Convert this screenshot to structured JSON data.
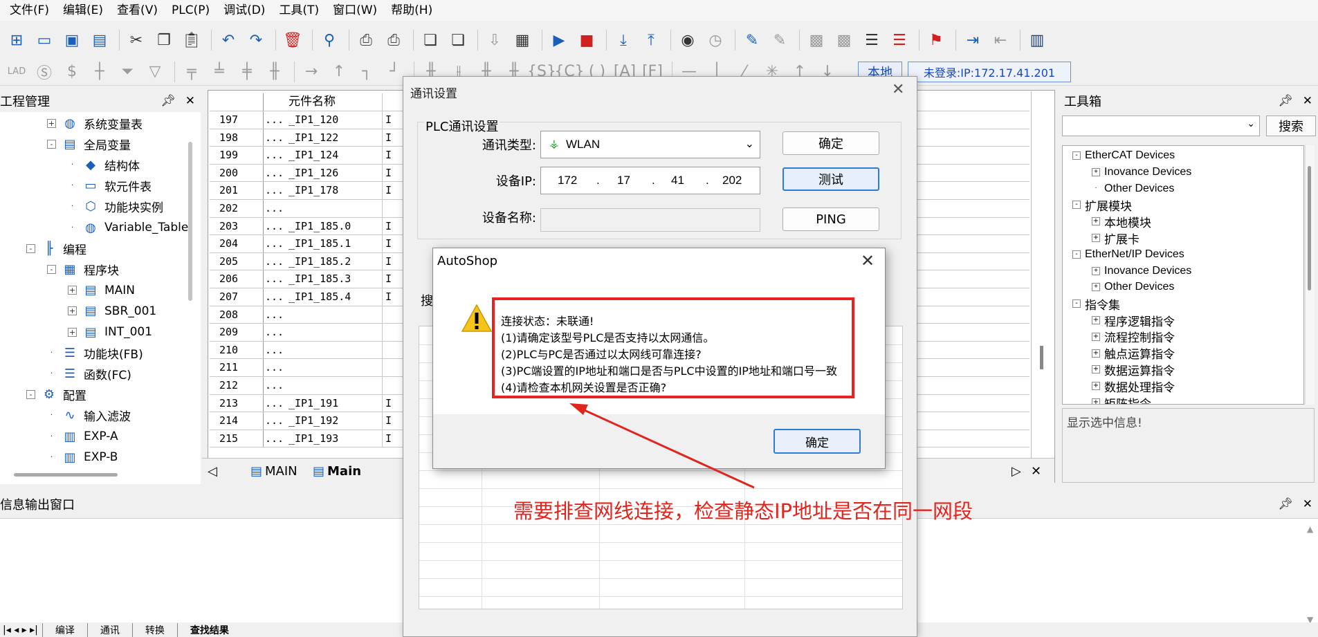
{
  "menu": [
    "文件(F)",
    "编辑(E)",
    "查看(V)",
    "PLC(P)",
    "调试(D)",
    "工具(T)",
    "窗口(W)",
    "帮助(H)"
  ],
  "toolbar": {
    "local_label": "本地",
    "login_status": "未登录:IP:172.17.41.201"
  },
  "project": {
    "title": "工程管理",
    "nodes": [
      {
        "label": "系统变量表",
        "level": 1,
        "box": "+",
        "icon": "globe-icon"
      },
      {
        "label": "全局变量",
        "level": 1,
        "box": "-",
        "icon": "table-icon"
      },
      {
        "label": "结构体",
        "level": 2,
        "box": "",
        "icon": "struct-icon"
      },
      {
        "label": "软元件表",
        "level": 2,
        "box": "",
        "icon": "device-table-icon"
      },
      {
        "label": "功能块实例",
        "level": 2,
        "box": "",
        "icon": "cube-icon"
      },
      {
        "label": "Variable_Table",
        "level": 2,
        "box": "",
        "icon": "globe-icon"
      },
      {
        "label": "编程",
        "level": 0,
        "box": "-",
        "icon": "ladder-icon"
      },
      {
        "label": "程序块",
        "level": 1,
        "box": "-",
        "icon": "blocks-icon"
      },
      {
        "label": "MAIN",
        "level": 2,
        "box": "+",
        "icon": "main-program-icon"
      },
      {
        "label": "SBR_001",
        "level": 2,
        "box": "+",
        "icon": "subroutine-icon"
      },
      {
        "label": "INT_001",
        "level": 2,
        "box": "+",
        "icon": "interrupt-icon"
      },
      {
        "label": "功能块(FB)",
        "level": 1,
        "box": "",
        "icon": "fb-icon"
      },
      {
        "label": "函数(FC)",
        "level": 1,
        "box": "",
        "icon": "fc-icon"
      },
      {
        "label": "配置",
        "level": 0,
        "box": "-",
        "icon": "config-icon"
      },
      {
        "label": "输入滤波",
        "level": 1,
        "box": "",
        "icon": "filter-icon"
      },
      {
        "label": "EXP-A",
        "level": 1,
        "box": "",
        "icon": "module-icon"
      },
      {
        "label": "EXP-B",
        "level": 1,
        "box": "",
        "icon": "module-icon"
      }
    ]
  },
  "editor": {
    "header": "元件名称",
    "rows": [
      {
        "n": "197",
        "d": "...",
        "name": "_IP1_120",
        "t": "I"
      },
      {
        "n": "198",
        "d": "...",
        "name": "_IP1_122",
        "t": "I"
      },
      {
        "n": "199",
        "d": "...",
        "name": "_IP1_124",
        "t": "I"
      },
      {
        "n": "200",
        "d": "...",
        "name": "_IP1_126",
        "t": "I"
      },
      {
        "n": "201",
        "d": "...",
        "name": "_IP1_178",
        "t": "I"
      },
      {
        "n": "202",
        "d": "...",
        "name": "",
        "t": ""
      },
      {
        "n": "203",
        "d": "...",
        "name": "_IP1_185.0",
        "t": "I"
      },
      {
        "n": "204",
        "d": "...",
        "name": "_IP1_185.1",
        "t": "I"
      },
      {
        "n": "205",
        "d": "...",
        "name": "_IP1_185.2",
        "t": "I"
      },
      {
        "n": "206",
        "d": "...",
        "name": "_IP1_185.3",
        "t": "I"
      },
      {
        "n": "207",
        "d": "...",
        "name": "_IP1_185.4",
        "t": "I"
      },
      {
        "n": "208",
        "d": "...",
        "name": "",
        "t": ""
      },
      {
        "n": "209",
        "d": "...",
        "name": "",
        "t": ""
      },
      {
        "n": "210",
        "d": "...",
        "name": "",
        "t": ""
      },
      {
        "n": "211",
        "d": "...",
        "name": "",
        "t": ""
      },
      {
        "n": "212",
        "d": "...",
        "name": "",
        "t": ""
      },
      {
        "n": "213",
        "d": "...",
        "name": "_IP1_191",
        "t": "I"
      },
      {
        "n": "214",
        "d": "...",
        "name": "_IP1_192",
        "t": "I"
      },
      {
        "n": "215",
        "d": "...",
        "name": "_IP1_193",
        "t": "I"
      }
    ],
    "tabs": [
      "MAIN",
      "Main"
    ]
  },
  "toolbox": {
    "title": "工具箱",
    "search_label": "搜索",
    "info": "显示选中信息!",
    "nodes": [
      {
        "label": "EtherCAT Devices",
        "level": 0,
        "box": "-"
      },
      {
        "label": "Inovance Devices",
        "level": 1,
        "box": "+"
      },
      {
        "label": "Other Devices",
        "level": 1,
        "box": ""
      },
      {
        "label": "扩展模块",
        "level": 0,
        "box": "-"
      },
      {
        "label": "本地模块",
        "level": 1,
        "box": "+"
      },
      {
        "label": "扩展卡",
        "level": 1,
        "box": "+"
      },
      {
        "label": "EtherNet/IP Devices",
        "level": 0,
        "box": "-"
      },
      {
        "label": "Inovance Devices",
        "level": 1,
        "box": "+"
      },
      {
        "label": "Other Devices",
        "level": 1,
        "box": "+"
      },
      {
        "label": "指令集",
        "level": 0,
        "box": "-"
      },
      {
        "label": "程序逻辑指令",
        "level": 1,
        "box": "+"
      },
      {
        "label": "流程控制指令",
        "level": 1,
        "box": "+"
      },
      {
        "label": "触点运算指令",
        "level": 1,
        "box": "+"
      },
      {
        "label": "数据运算指令",
        "level": 1,
        "box": "+"
      },
      {
        "label": "数据处理指令",
        "level": 1,
        "box": "+"
      },
      {
        "label": "矩阵指令",
        "level": 1,
        "box": "+"
      }
    ]
  },
  "message_window": {
    "title": "信息输出窗口",
    "tabs": [
      "编译",
      "通讯",
      "转换",
      "查找结果"
    ]
  },
  "comm_dialog": {
    "title": "通讯设置",
    "group_title": "PLC通讯设置",
    "type_label": "通讯类型:",
    "type_value": "WLAN",
    "ip_label": "设备IP:",
    "ip": [
      "172",
      "17",
      "41",
      "202"
    ],
    "name_label": "设备名称:",
    "ok_label": "确定",
    "test_label": "测试",
    "ping_label": "PING",
    "inner_tab": "搜"
  },
  "msgbox": {
    "title": "AutoShop",
    "lines": [
      "连接状态：未联通!",
      "(1)请确定该型号PLC是否支持以太网通信。",
      "(2)PLC与PC是否通过以太网线可靠连接?",
      "(3)PC端设置的IP地址和端口是否与PLC中设置的IP地址和端口号一致",
      "(4)请检查本机网关设置是否正确?"
    ],
    "ok_label": "确定"
  },
  "annotation": {
    "text": "需要排查网线连接，检查静态IP地址是否在同一网段",
    "color": "#e2241d"
  }
}
